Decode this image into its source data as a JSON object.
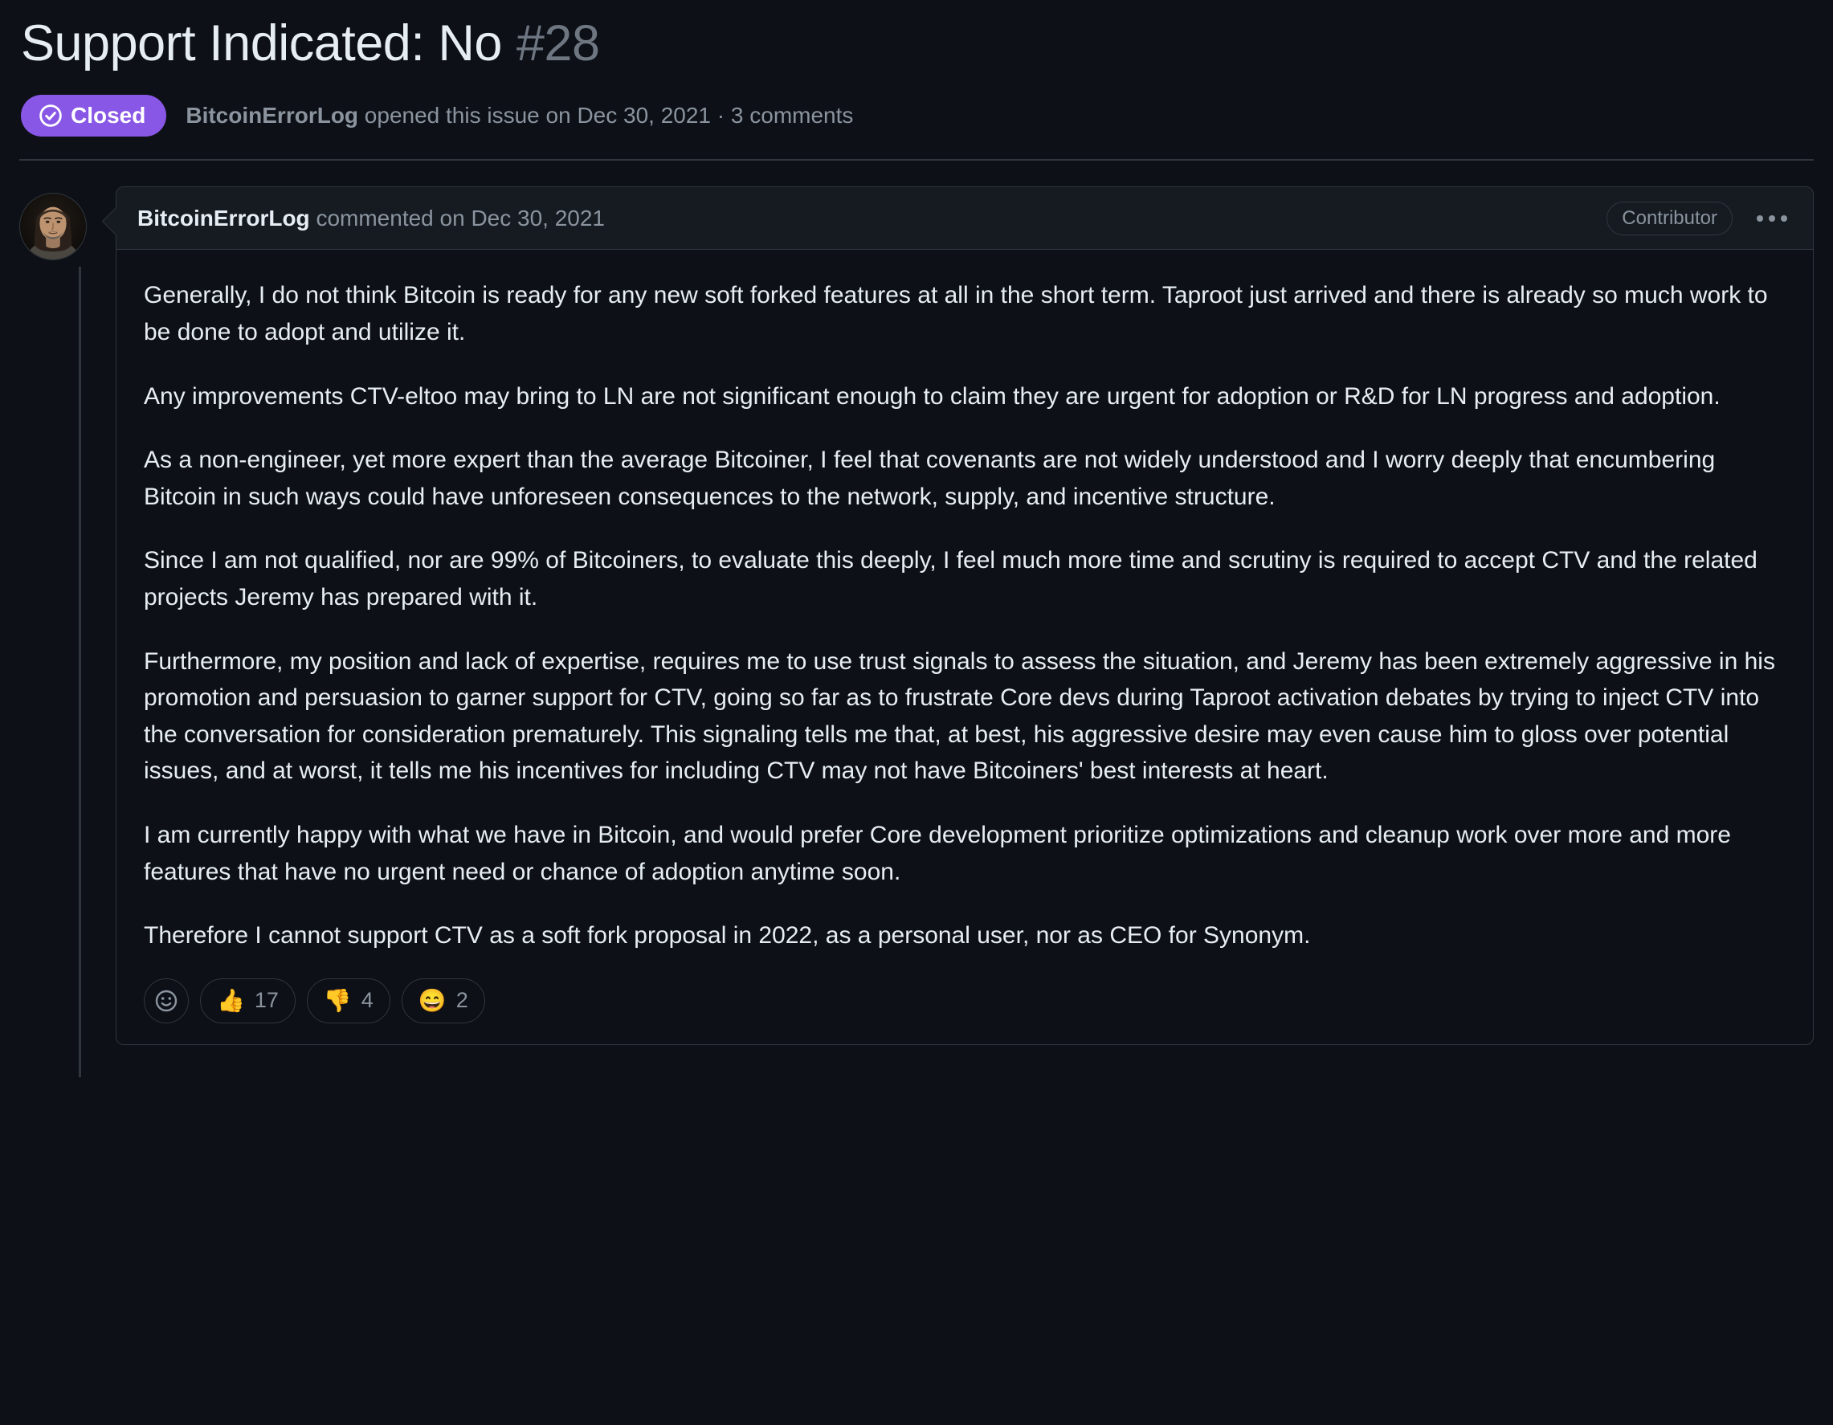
{
  "issue": {
    "title": "Support Indicated: No",
    "number": "#28",
    "state_label": "Closed",
    "state_color": "#8957e5",
    "state_icon": "check-circle-icon",
    "meta_author": "BitcoinErrorLog",
    "meta_rest": " opened this issue on Dec 30, 2021 · 3 comments"
  },
  "comment": {
    "author": "BitcoinErrorLog",
    "header_rest": " commented on Dec 30, 2021",
    "contributor_badge": "Contributor",
    "menu_icon": "kebab-horizontal-icon",
    "avatar_icon": "user-avatar",
    "paragraphs": [
      "Generally, I do not think Bitcoin is ready for any new soft forked features at all in the short term. Taproot just arrived and there is already so much work to be done to adopt and utilize it.",
      "Any improvements CTV-eltoo may bring to LN are not significant enough to claim they are urgent for adoption or R&D for LN progress and adoption.",
      "As a non-engineer, yet more expert than the average Bitcoiner, I feel that covenants are not widely understood and I worry deeply that encumbering Bitcoin in such ways could have unforeseen consequences to the network, supply, and incentive structure.",
      "Since I am not qualified, nor are 99% of Bitcoiners, to evaluate this deeply, I feel much more time and scrutiny is required to accept CTV and the related projects Jeremy has prepared with it.",
      "Furthermore, my position and lack of expertise, requires me to use trust signals to assess the situation, and Jeremy has been extremely aggressive in his promotion and persuasion to garner support for CTV, going so far as to frustrate Core devs during Taproot activation debates by trying to inject CTV into the conversation for consideration prematurely. This signaling tells me that, at best, his aggressive desire may even cause him to gloss over potential issues, and at worst, it tells me his incentives for including CTV may not have Bitcoiners' best interests at heart.",
      "I am currently happy with what we have in Bitcoin, and would prefer Core development prioritize optimizations and cleanup work over more and more features that have no urgent need or chance of adoption anytime soon.",
      "Therefore I cannot support CTV as a soft fork proposal in 2022, as a personal user, nor as CEO for Synonym."
    ],
    "reactions": {
      "add_icon": "smiley-plus-icon",
      "items": [
        {
          "emoji": "👍",
          "name": "thumbs-up",
          "count": "17"
        },
        {
          "emoji": "👎",
          "name": "thumbs-down",
          "count": "4"
        },
        {
          "emoji": "😄",
          "name": "laugh",
          "count": "2"
        }
      ]
    }
  },
  "theme": {
    "background": "#0d1117",
    "surface": "#161b22",
    "border": "#30363d",
    "text_primary": "#e6edf3",
    "text_muted": "#8b949e",
    "accent_purple": "#8957e5"
  }
}
